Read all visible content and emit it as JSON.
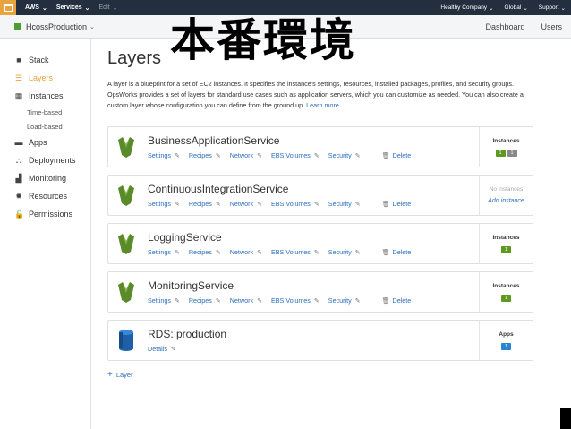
{
  "topbar": {
    "brand": "AWS",
    "services": "Services",
    "edit": "Edit",
    "account": "Healthy Company",
    "region": "Global",
    "support": "Support"
  },
  "subbar": {
    "stack_name": "HcossProduction",
    "dashboard": "Dashboard",
    "users": "Users"
  },
  "sidebar": {
    "items": [
      {
        "label": "Stack",
        "icon": "stack-icon"
      },
      {
        "label": "Layers",
        "icon": "layers-icon",
        "active": true
      },
      {
        "label": "Instances",
        "icon": "instances-icon"
      },
      {
        "label": "Time-based"
      },
      {
        "label": "Load-based"
      },
      {
        "label": "Apps",
        "icon": "apps-icon"
      },
      {
        "label": "Deployments",
        "icon": "deployments-icon"
      },
      {
        "label": "Monitoring",
        "icon": "monitoring-icon"
      },
      {
        "label": "Resources",
        "icon": "resources-icon"
      },
      {
        "label": "Permissions",
        "icon": "lock-icon"
      }
    ]
  },
  "main": {
    "title": "Layers",
    "overlay": "本番環境",
    "description": "A layer is a blueprint for a set of EC2 instances. It specifies the instance's settings, resources, installed packages, profiles, and security groups. OpsWorks provides a set of layers for standard use cases such as application servers, which you can customize as needed. You can also create a custom layer whose configuration you can define from the ground up.",
    "learn_more": "Learn more.",
    "link_labels": {
      "settings": "Settings",
      "recipes": "Recipes",
      "network": "Network",
      "ebs": "EBS Volumes",
      "security": "Security",
      "delete": "Delete",
      "details": "Details"
    },
    "layers": [
      {
        "name": "BusinessApplicationService",
        "side_label": "Instances",
        "badges": [
          "1",
          "1"
        ]
      },
      {
        "name": "ContinuousIntegrationService",
        "side_label": "No instances",
        "add": "Add instance"
      },
      {
        "name": "LoggingService",
        "side_label": "Instances",
        "badges": [
          "1"
        ]
      },
      {
        "name": "MonitoringService",
        "side_label": "Instances",
        "badges": [
          "1"
        ]
      },
      {
        "name": "RDS: production",
        "side_label": "Apps",
        "badges": [
          "1"
        ]
      }
    ],
    "add_layer": "Layer"
  },
  "colors": {
    "topbar": "#232f3e",
    "accent": "#e7a33e",
    "link": "#2a6ebb",
    "green": "#5b9a1e"
  }
}
